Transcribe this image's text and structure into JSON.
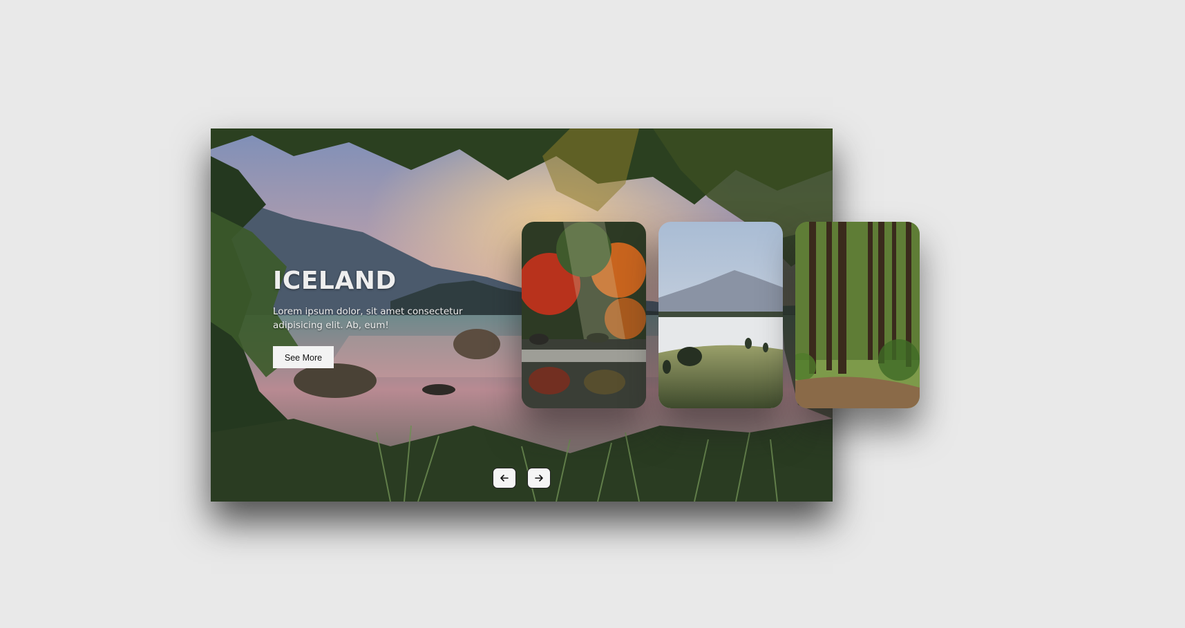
{
  "slide": {
    "title": "ICELAND",
    "description": "Lorem ipsum dolor, sit amet consectetur adipisicing elit. Ab, eum!",
    "button_label": "See More"
  },
  "cards": [
    {
      "scene": "autumn-river"
    },
    {
      "scene": "misty-valley"
    },
    {
      "scene": "forest-path"
    }
  ],
  "navigation": {
    "prev_icon": "arrow-left-icon",
    "next_icon": "arrow-right-icon"
  },
  "colors": {
    "page_background": "#e9e9e9",
    "button_background": "#f3f3f3"
  }
}
